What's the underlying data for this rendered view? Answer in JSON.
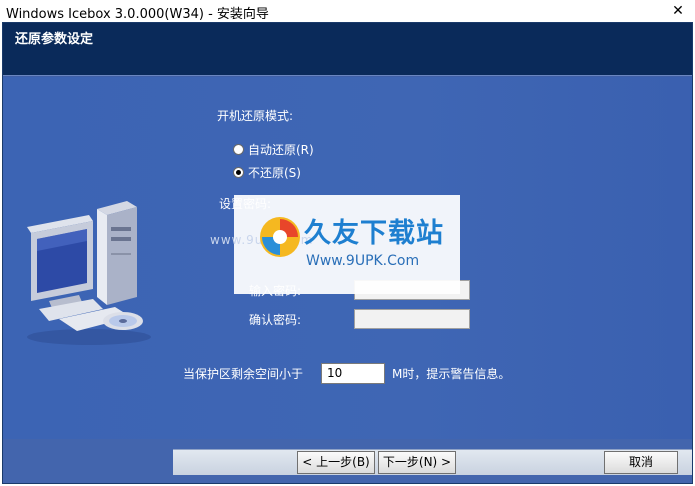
{
  "window": {
    "title": "Windows Icebox 3.0.000(W34) - 安装向导",
    "close_glyph": "✕"
  },
  "header": {
    "title": "还原参数设定"
  },
  "restore": {
    "label": "开机还原模式:",
    "options": [
      {
        "label": "自动还原(R)",
        "checked": false
      },
      {
        "label": "不还原(S)",
        "checked": true
      }
    ]
  },
  "password": {
    "label": "设置密码:",
    "enter_label": "输入密码:",
    "confirm_label": "确认密码:"
  },
  "space": {
    "prefix": "当保护区剩余空间小于",
    "value": "10",
    "suffix": "M时，提示警告信息。"
  },
  "watermark": {
    "title": "久友下载站",
    "url": "Www.9UPK.Com",
    "ghost": "www.9upk.com"
  },
  "buttons": {
    "prev": "< 上一步(B)",
    "next": "下一步(N) >",
    "cancel": "取消"
  },
  "colors": {
    "header": "#0a2a5a",
    "content": "#3f66b4",
    "accent": "#1e7fd0"
  }
}
